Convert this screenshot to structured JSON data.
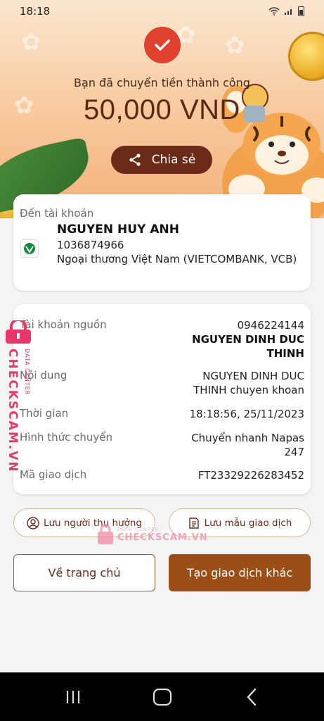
{
  "status_bar": {
    "time": "18:18"
  },
  "hero": {
    "success_message": "Bạn đã chuyển tiền thành công",
    "amount": "50,000 VND",
    "share_label": "Chia sẻ"
  },
  "recipient": {
    "section_label": "Đến tài khoản",
    "name": "NGUYEN HUY ANH",
    "account_number": "1036874966",
    "bank_name": "Ngoại thương Việt Nam (VIETCOMBANK, VCB)"
  },
  "details": {
    "source_account_label": "Tài khoản nguồn",
    "source_account_number": "0946224144",
    "source_account_name": "NGUYEN DINH DUC THINH",
    "content_label": "Nội dung",
    "content_value": "NGUYEN DINH DUC THINH chuyen khoan",
    "time_label": "Thời gian",
    "time_value": "18:18:56, 25/11/2023",
    "method_label": "Hình thức chuyển",
    "method_value": "Chuyển nhanh Napas 247",
    "txn_id_label": "Mã giao dịch",
    "txn_id_value": "FT23329226283452"
  },
  "actions": {
    "save_beneficiary": "Lưu người thụ hưởng",
    "save_template": "Lưu mẫu giao dịch",
    "home": "Về trang chủ",
    "new_transaction": "Tạo giao dịch khác"
  },
  "watermark": {
    "brand": "CHECKSCAM.VN",
    "sub": "DATA CENTER"
  },
  "colors": {
    "brand_brown": "#6b2a17",
    "primary_button": "#9b4f16",
    "success_red": "#e0402e"
  }
}
